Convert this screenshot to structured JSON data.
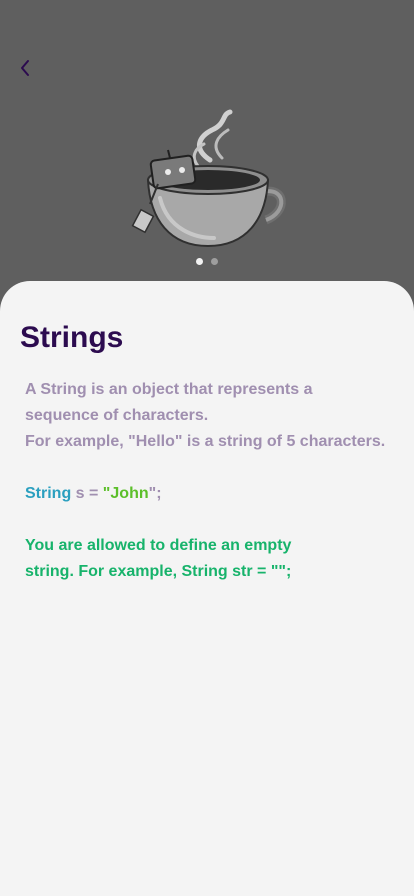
{
  "nav": {
    "back_icon": "chevron-left-icon"
  },
  "hero": {
    "image": "teacup-robot-illustration"
  },
  "pager": {
    "count": 2,
    "active_index": 0
  },
  "content": {
    "title": "Strings",
    "desc_line1": "A String is an object that represents a",
    "desc_line2": "sequence of characters.",
    "desc_line3": "For example, \"Hello\" is a string of 5 characters.",
    "code": {
      "keyword": "String",
      "assign": " s = ",
      "quote_open": "\"",
      "value": "John",
      "quote_close": "\";"
    },
    "note_line1": "You are allowed to define an empty",
    "note_line2": "string. For example, String str = \"\";"
  },
  "colors": {
    "background": "#5f5f5f",
    "sheet": "#f4f4f4",
    "title": "#2c0b4f",
    "description": "#a08fb0",
    "keyword": "#2a9fbf",
    "string": "#5cbf2a",
    "note": "#17b36b"
  }
}
